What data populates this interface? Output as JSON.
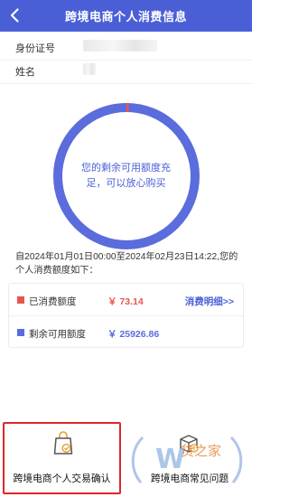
{
  "header": {
    "title": "跨境电商个人消费信息",
    "back_icon": "back-chevron-icon"
  },
  "identity": {
    "id_label": "身份证号",
    "name_label": "姓名"
  },
  "quota_ring": {
    "message": "您的剩余可用额度充足，可以放心购买",
    "used_fraction": 0.0028,
    "ring_color": "#5b6cdc",
    "used_color": "#e8554f"
  },
  "summary": {
    "text": "自2024年01月01日00:00至2024年02月23日14:22,您的个人消费额度如下："
  },
  "quota": {
    "used_label": "已消费额度",
    "used_amount": "￥ 73.14",
    "used_color": "#e8554f",
    "detail_link": "消费明细>>",
    "remaining_label": "剩余可用额度",
    "remaining_amount": "￥ 25926.86",
    "remaining_color": "#5b6cdc"
  },
  "bottom_nav": {
    "confirm_label": "跨境电商个人交易确认",
    "faq_label": "跨境电商常见问题",
    "highlight_color": "#e0262b"
  },
  "watermark": {
    "text": "货之家"
  }
}
